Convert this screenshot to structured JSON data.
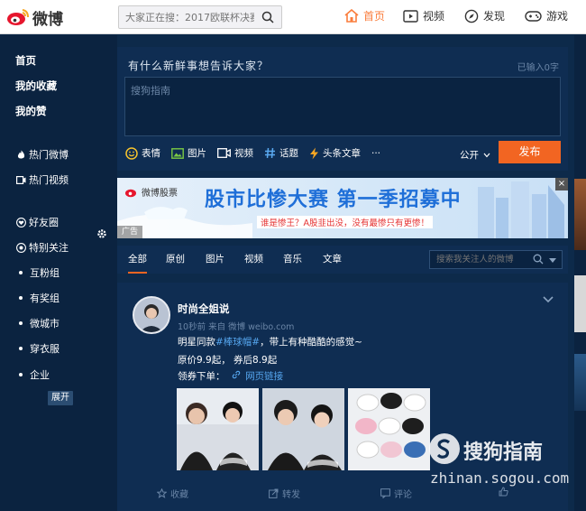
{
  "app": {
    "logo_text": "微博"
  },
  "search": {
    "placeholder": "大家正在搜：2017欧联杯决赛"
  },
  "nav": {
    "home": "首页",
    "video": "视频",
    "discover": "发现",
    "game": "游戏"
  },
  "sidebar": {
    "top": [
      "首页",
      "我的收藏",
      "我的赞"
    ],
    "hot_weibo": "热门微博",
    "hot_video": "热门视频",
    "friends": "好友圈",
    "special": "特别关注",
    "groups": [
      "互粉组",
      "有奖组",
      "微城市",
      "穿衣服",
      "企业"
    ],
    "expand": "展开"
  },
  "publisher": {
    "prompt": "有什么新鲜事想告诉大家？",
    "count": "已输入0字",
    "placeholder": "搜狗指南",
    "tools": [
      "表情",
      "图片",
      "视频",
      "话题",
      "头条文章",
      "···"
    ],
    "visibility": "公开",
    "send": "发布"
  },
  "banner": {
    "brand": "微博股票",
    "headline": "股市比惨大赛 第一季招募中",
    "sub": "谁是惨王？A股韭出没，没有最惨只有更惨！",
    "tag": "广告",
    "close": "×"
  },
  "feed_tabs": {
    "tabs": [
      "全部",
      "原创",
      "图片",
      "视频",
      "音乐",
      "文章"
    ],
    "search_placeholder": "搜索我关注人的微博"
  },
  "post": {
    "author": "时尚全姐说",
    "meta": "10秒前 来自 微博 weibo.com",
    "line1_pre": "明星同款",
    "line1_tag": "#棒球帽#",
    "line1_post": "，带上有种酷酷的感觉~",
    "line2": "原价9.9起， 券后8.9起",
    "line3_pre": "领券下单：",
    "line3_link": "网页链接",
    "actions": [
      "收藏",
      "转发",
      "评论",
      ""
    ]
  },
  "watermark": {
    "brand": "搜狗指南",
    "url": "zhinan.sogou.com"
  },
  "colors": {
    "accent": "#f26522",
    "nav_active": "#fa7d3c",
    "link": "#56a7f0",
    "bg": "#0d2a4a",
    "panel": "#0f2d52"
  }
}
